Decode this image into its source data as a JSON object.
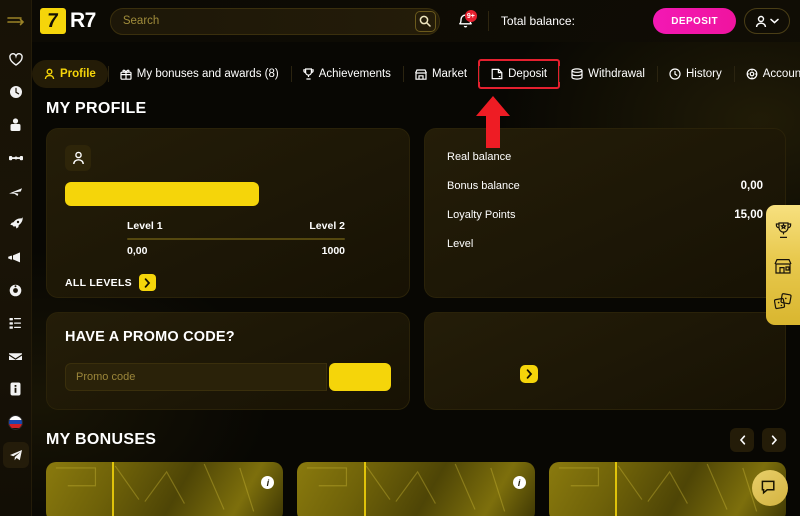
{
  "header": {
    "logo_text": "R7",
    "logo_mark_letter": "7",
    "search_placeholder": "Search",
    "search_value": "",
    "search_icon": "search-icon",
    "bell_icon": "bell-icon",
    "bell_badge": "9+",
    "balance_label": "Total balance:",
    "deposit_label": "DEPOSIT",
    "user_icon": "user-icon",
    "user_chevron": "chevron-down-icon"
  },
  "sidebar": {
    "items": [
      {
        "icon": "collapse-arrow-icon",
        "name": "menu-collapse"
      },
      {
        "icon": "heart-icon",
        "name": "favorites"
      },
      {
        "icon": "clock-icon",
        "name": "recent"
      },
      {
        "icon": "slots-icon",
        "name": "slots"
      },
      {
        "icon": "sports-icon",
        "name": "sports"
      },
      {
        "icon": "aviator-icon",
        "name": "aviator"
      },
      {
        "icon": "rocket-icon",
        "name": "crash-games"
      },
      {
        "icon": "megaphone-icon",
        "name": "promotions"
      },
      {
        "icon": "roulette-icon",
        "name": "live-casino"
      },
      {
        "icon": "leaderboard-icon",
        "name": "tournaments"
      },
      {
        "icon": "envelope-icon",
        "name": "messages"
      },
      {
        "icon": "info-icon",
        "name": "info"
      },
      {
        "icon": "flag-ru-icon",
        "name": "language"
      },
      {
        "icon": "telegram-icon",
        "name": "telegram"
      }
    ]
  },
  "nav": {
    "tabs": [
      {
        "label": "Profile",
        "icon": "user-icon",
        "active": true,
        "highlight": false
      },
      {
        "label": "My bonuses and awards (8)",
        "icon": "gift-icon",
        "active": false,
        "highlight": false
      },
      {
        "label": "Achievements",
        "icon": "trophy-icon",
        "active": false,
        "highlight": false
      },
      {
        "label": "Market",
        "icon": "shop-icon",
        "active": false,
        "highlight": false
      },
      {
        "label": "Deposit",
        "icon": "wallet-icon",
        "active": false,
        "highlight": true
      },
      {
        "label": "Withdrawal",
        "icon": "cash-icon",
        "active": false,
        "highlight": false
      },
      {
        "label": "History",
        "icon": "history-icon",
        "active": false,
        "highlight": false
      },
      {
        "label": "Account Settin",
        "icon": "gear-icon",
        "active": false,
        "highlight": false
      }
    ],
    "next_icon": "chevron-right-icon"
  },
  "annotation": {
    "arrow_color": "#ee1c24",
    "points_at": "Deposit"
  },
  "main": {
    "profile_section_title": "MY PROFILE",
    "profile": {
      "avatar_icon": "user-icon",
      "name_value": "",
      "level_left_label": "Level 1",
      "level_right_label": "Level 2",
      "level_left_value": "0,00",
      "level_right_value": "1000",
      "progress_percent": 0,
      "all_levels_label": "ALL LEVELS",
      "all_levels_icon": "chevron-right-icon"
    },
    "balance": {
      "rows": [
        {
          "label": "Real balance",
          "value": ""
        },
        {
          "label": "Bonus balance",
          "value": "0,00"
        },
        {
          "label": "Loyalty Points",
          "value": "15,00"
        },
        {
          "label": "Level",
          "value": ""
        }
      ]
    },
    "promo": {
      "title": "HAVE A PROMO CODE?",
      "input_placeholder": "Promo code",
      "input_value": "",
      "button_label": ""
    },
    "extra_card": {
      "chevron_icon": "chevron-right-icon"
    },
    "bonuses": {
      "title": "MY BONUSES",
      "prev_icon": "chevron-left-icon",
      "next_icon": "chevron-right-icon",
      "cards": [
        {
          "info_icon": "info-icon",
          "label": ""
        },
        {
          "info_icon": "info-icon",
          "label": ""
        },
        {
          "info_icon": "info-icon",
          "label": ""
        }
      ]
    }
  },
  "side_widget": {
    "items": [
      {
        "icon": "trophy-icon",
        "name": "tournaments-widget"
      },
      {
        "icon": "shop-icon",
        "name": "shop-widget"
      },
      {
        "icon": "dice-icon",
        "name": "games-widget"
      }
    ]
  },
  "chat": {
    "icon": "chat-icon"
  },
  "colors": {
    "accent_yellow": "#f5d50a",
    "deposit_pink": "#f318b4",
    "annotation_red": "#ee1c24",
    "background": "#080703",
    "card_bg": "#241d08"
  }
}
